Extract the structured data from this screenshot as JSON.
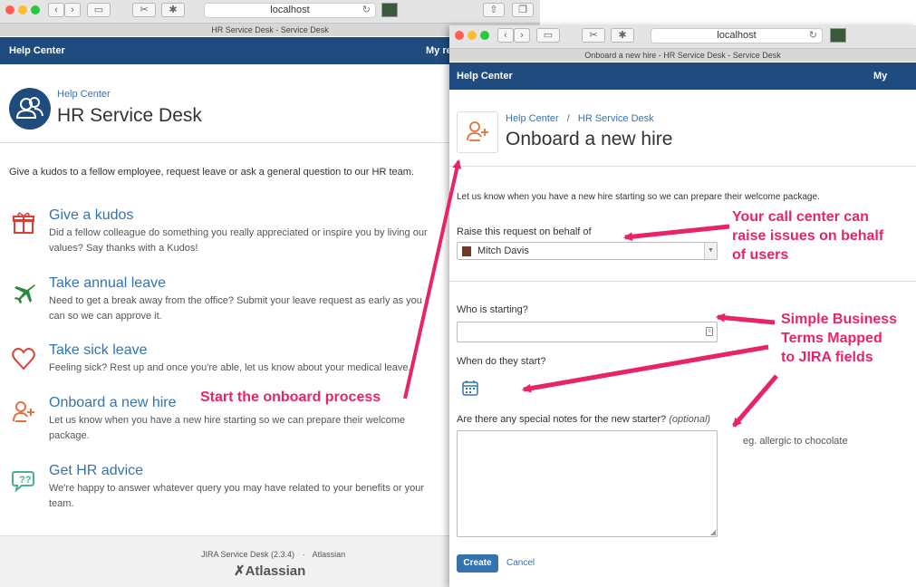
{
  "left": {
    "browser": {
      "url": "localhost",
      "tab_title": "HR Service Desk - Service Desk"
    },
    "nav": {
      "help_center": "Help Center",
      "my_requests": "My re"
    },
    "header": {
      "breadcrumb": "Help Center",
      "title": "HR Service Desk"
    },
    "intro": "Give a kudos to a fellow employee, request leave or ask a general question to our HR team.",
    "services": [
      {
        "title": "Give a kudos",
        "desc": "Did a fellow colleague do something you really appreciated or inspire you by living our values? Say thanks with a Kudos!",
        "icon": "gift-icon"
      },
      {
        "title": "Take annual leave",
        "desc": "Need to get a break away from the office? Submit your leave request as early as you can so we can approve it.",
        "icon": "airplane-icon"
      },
      {
        "title": "Take sick leave",
        "desc": "Feeling sick? Rest up and once you're able, let us know about your medical leave.",
        "icon": "heart-icon"
      },
      {
        "title": "Onboard a new hire",
        "desc": "Let us know when you have a new hire starting so we can prepare their welcome package.",
        "icon": "add-user-icon"
      },
      {
        "title": "Get HR advice",
        "desc": "We're happy to answer whatever query you may have related to your benefits or your team.",
        "icon": "chat-question-icon"
      }
    ],
    "footer": {
      "version": "JIRA Service Desk (2.3.4)",
      "sep": "·",
      "company": "Atlassian",
      "logo": "Atlassian"
    }
  },
  "right": {
    "browser": {
      "url": "localhost",
      "tab_title": "Onboard a new hire - HR Service Desk - Service Desk"
    },
    "nav": {
      "help_center": "Help Center",
      "my_requests": "My reques"
    },
    "breadcrumb": {
      "item1": "Help Center",
      "sep": "/",
      "item2": "HR Service Desk"
    },
    "title": "Onboard a new hire",
    "intro": "Let us know when you have a new hire starting so we can prepare their welcome package.",
    "form": {
      "on_behalf_label": "Raise this request on behalf of",
      "on_behalf_value": "Mitch Davis",
      "who_label": "Who is starting?",
      "who_value": "",
      "when_label": "When do they start?",
      "notes_label": "Are there any special notes for the new starter?",
      "notes_optional": "(optional)",
      "notes_value": "",
      "notes_hint": "eg. allergic to chocolate",
      "create": "Create",
      "cancel": "Cancel"
    }
  },
  "annotations": {
    "onboard": "Start the onboard process",
    "call_center": [
      "Your call center can",
      "raise issues on behalf",
      "of users"
    ],
    "business_terms": [
      "Simple Business",
      "Terms Mapped",
      "to JIRA fields"
    ]
  },
  "colors": {
    "nav_blue": "#1f4b7e",
    "link": "#3572b0",
    "annotation": "#e8236b",
    "icon_orange": "#e8703a",
    "icon_red": "#d9403a",
    "icon_green": "#2e8540",
    "icon_teal": "#4caf8f"
  }
}
